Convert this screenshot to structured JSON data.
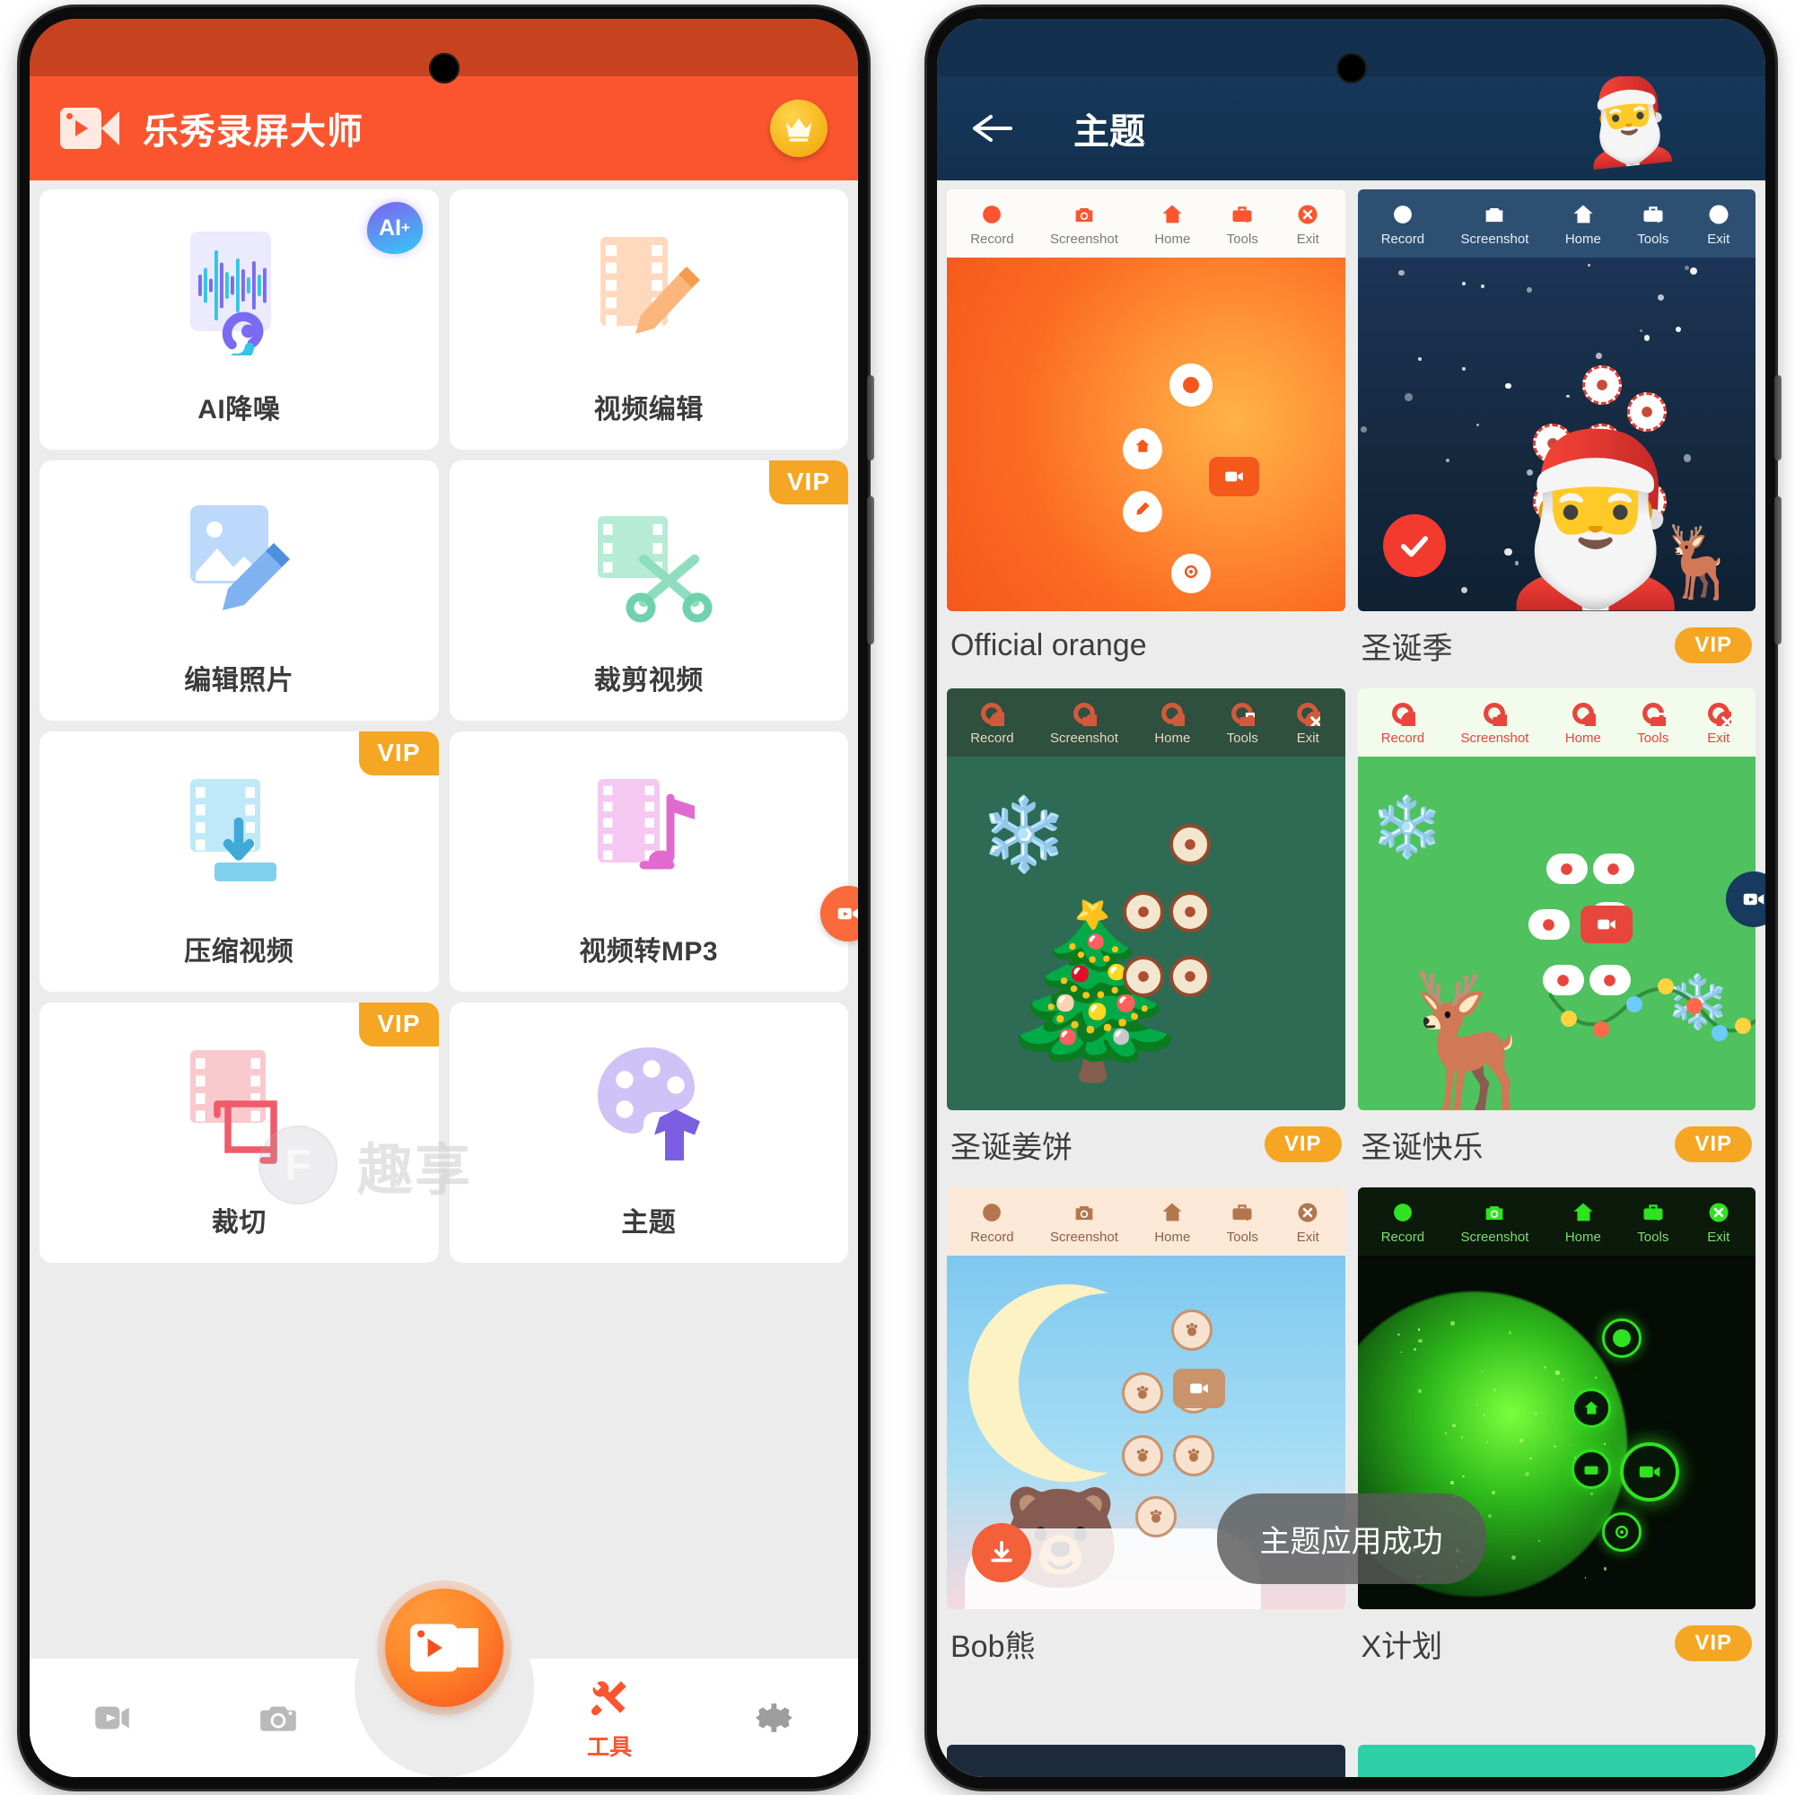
{
  "left_phone": {
    "app_title": "乐秀录屏大师",
    "logo_icon": "video-camera-icon",
    "vip_crown_icon": "crown-icon",
    "tools": [
      {
        "label": "AI降噪",
        "badge": "AI+",
        "badge_type": "ai",
        "icon": "waveform-ear-icon"
      },
      {
        "label": "视频编辑",
        "badge": "",
        "badge_type": "none",
        "icon": "film-pencil-icon"
      },
      {
        "label": "编辑照片",
        "badge": "",
        "badge_type": "none",
        "icon": "image-pencil-icon"
      },
      {
        "label": "裁剪视频",
        "badge": "VIP",
        "badge_type": "vip",
        "icon": "film-scissors-icon"
      },
      {
        "label": "压缩视频",
        "badge": "VIP",
        "badge_type": "vip",
        "icon": "film-compress-icon"
      },
      {
        "label": "视频转MP3",
        "badge": "",
        "badge_type": "none",
        "icon": "film-music-icon"
      },
      {
        "label": "裁切",
        "badge": "VIP",
        "badge_type": "vip",
        "icon": "film-crop-icon"
      },
      {
        "label": "主题",
        "badge": "",
        "badge_type": "none",
        "icon": "palette-shirt-icon"
      }
    ],
    "nav": [
      {
        "label": "",
        "icon": "video-play-icon",
        "active": false
      },
      {
        "label": "",
        "icon": "camera-icon",
        "active": false
      },
      {
        "label": "",
        "icon": "record-fab-icon",
        "active": false
      },
      {
        "label": "工具",
        "icon": "tools-icon",
        "active": true
      },
      {
        "label": "",
        "icon": "gear-icon",
        "active": false
      }
    ],
    "record_button_icon": "record-video-icon",
    "watermark": {
      "circle_text": "F",
      "text": "趣享"
    },
    "accent_color": "#fb5530",
    "vip_color": "#f5a623"
  },
  "right_phone": {
    "header": {
      "title": "主题",
      "back_icon": "back-arrow-icon",
      "decoration_icon": "santa-icon"
    },
    "preview_toolbar_labels": [
      "Record",
      "Screenshot",
      "Home",
      "Tools",
      "Exit"
    ],
    "themes": [
      {
        "name": "Official orange",
        "vip": false,
        "selected": false,
        "style": "orange"
      },
      {
        "name": "圣诞季",
        "vip": true,
        "selected": true,
        "style": "xmas-night"
      },
      {
        "name": "圣诞姜饼",
        "vip": true,
        "selected": false,
        "style": "gingerbread"
      },
      {
        "name": "圣诞快乐",
        "vip": true,
        "selected": false,
        "style": "xmas-green"
      },
      {
        "name": "Bob熊",
        "vip": false,
        "selected": false,
        "style": "bob-bear"
      },
      {
        "name": "X计划",
        "vip": true,
        "selected": false,
        "style": "x-plan"
      }
    ],
    "toast": "主题应用成功",
    "vip_badge_label": "VIP",
    "vip_color": "#f5a623",
    "header_bg": "#13314e"
  }
}
